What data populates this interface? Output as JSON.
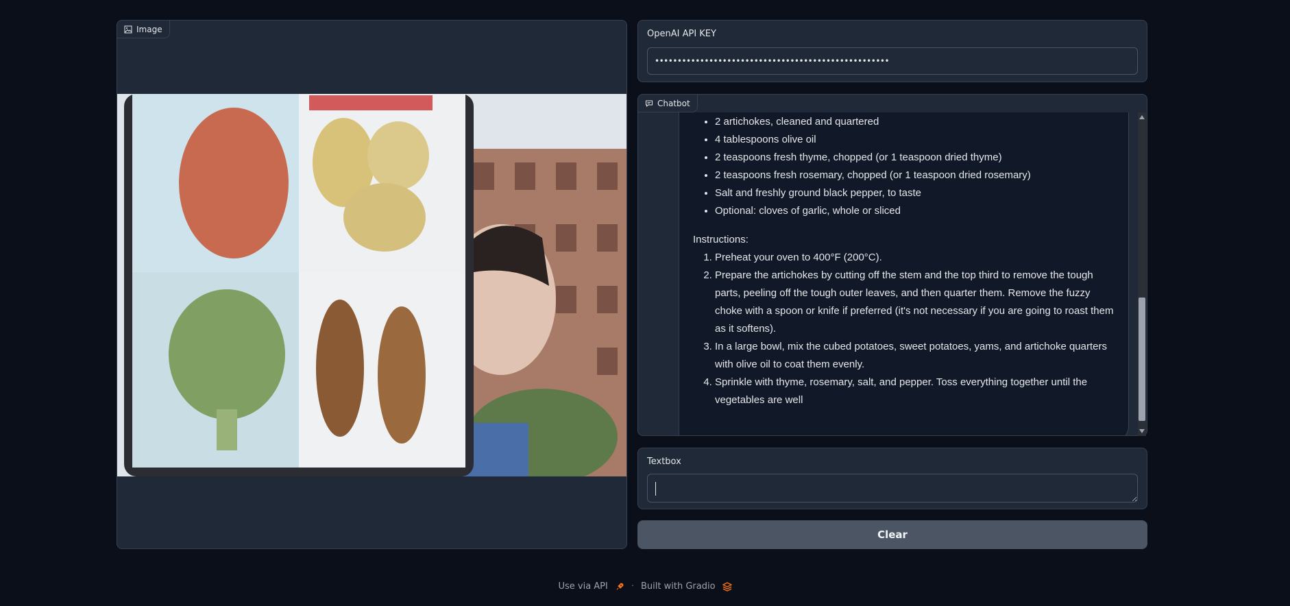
{
  "image_block": {
    "label": "Image"
  },
  "api_key": {
    "label": "OpenAI API KEY",
    "value": "••••••••••••••••••••••••••••••••••••••••••••••••••••"
  },
  "chatbot": {
    "label": "Chatbot",
    "ingredients": [
      "2 artichokes, cleaned and quartered",
      "4 tablespoons olive oil",
      "2 teaspoons fresh thyme, chopped (or 1 teaspoon dried thyme)",
      "2 teaspoons fresh rosemary, chopped (or 1 teaspoon dried rosemary)",
      "Salt and freshly ground black pepper, to taste",
      "Optional: cloves of garlic, whole or sliced"
    ],
    "instructions_heading": "Instructions:",
    "instructions": [
      "Preheat your oven to 400°F (200°C).",
      "Prepare the artichokes by cutting off the stem and the top third to remove the tough parts, peeling off the tough outer leaves, and then quarter them. Remove the fuzzy choke with a spoon or knife if preferred (it's not necessary if you are going to roast them as it softens).",
      "In a large bowl, mix the cubed potatoes, sweet potatoes, yams, and artichoke quarters with olive oil to coat them evenly.",
      "Sprinkle with thyme, rosemary, salt, and pepper. Toss everything together until the vegetables are well"
    ]
  },
  "textbox": {
    "label": "Textbox",
    "value": ""
  },
  "clear_button": {
    "label": "Clear"
  },
  "footer": {
    "api_link": "Use via API",
    "built_with": "Built with Gradio"
  }
}
